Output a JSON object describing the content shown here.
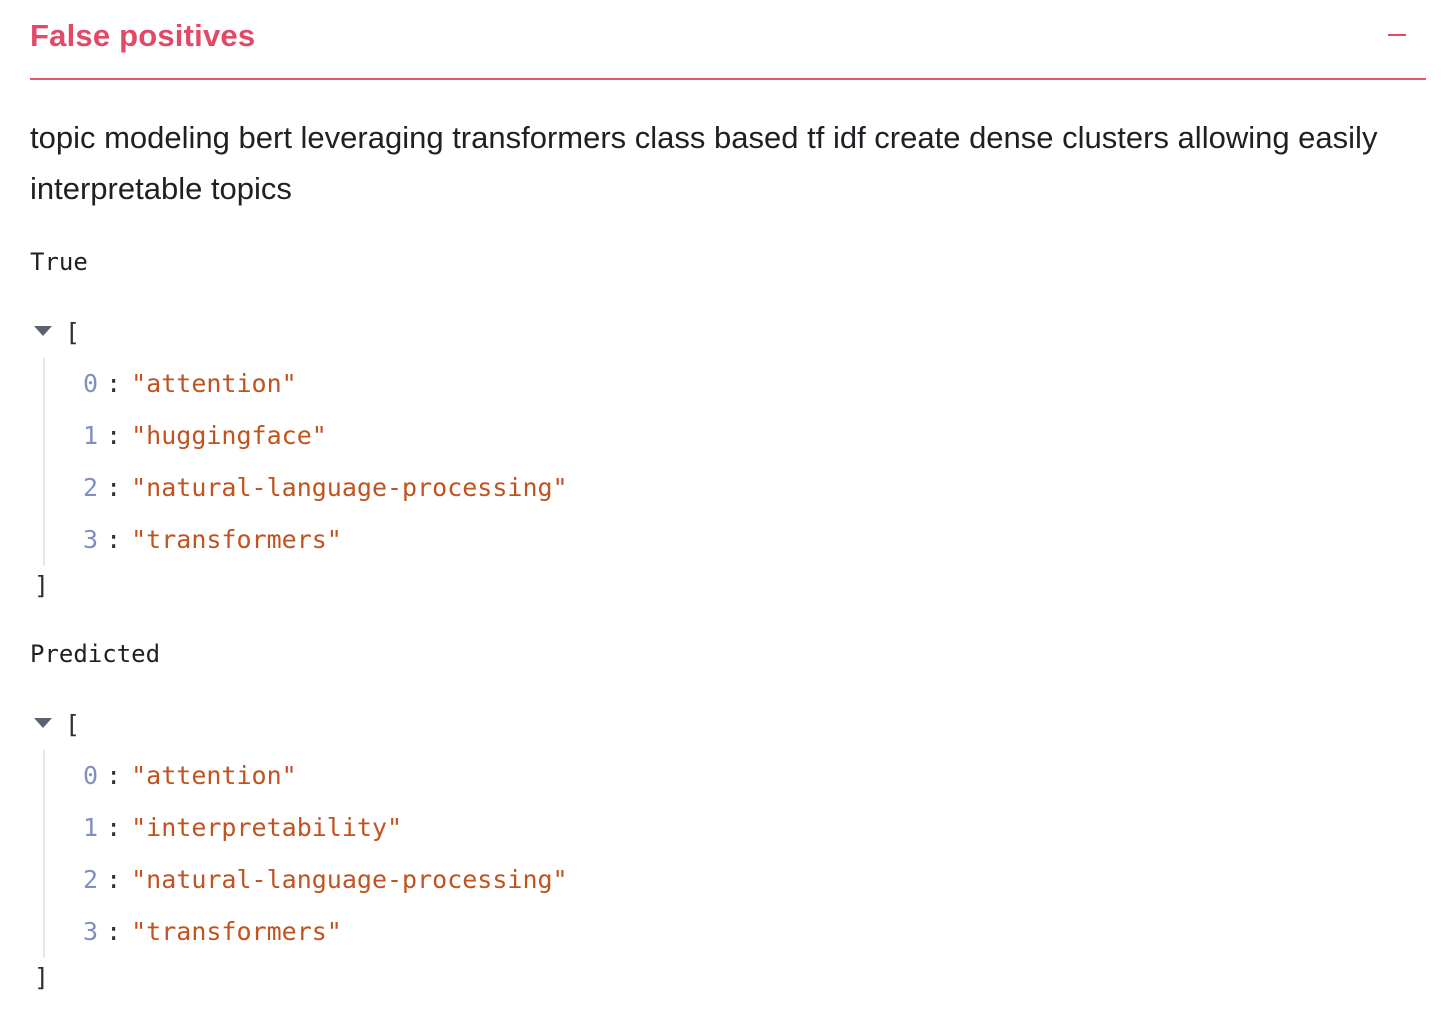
{
  "expander": {
    "title": "False positives",
    "collapse_icon": "minus-icon",
    "accent_color": "#e04a66"
  },
  "description": "topic modeling bert leveraging transformers class based tf idf create dense clusters allowing easily interpretable topics",
  "true_section": {
    "label": "True",
    "open_bracket": "[",
    "close_bracket": "]",
    "items": [
      {
        "index": "0",
        "value": "\"attention\""
      },
      {
        "index": "1",
        "value": "\"huggingface\""
      },
      {
        "index": "2",
        "value": "\"natural-language-processing\""
      },
      {
        "index": "3",
        "value": "\"transformers\""
      }
    ]
  },
  "predicted_section": {
    "label": "Predicted",
    "open_bracket": "[",
    "close_bracket": "]",
    "items": [
      {
        "index": "0",
        "value": "\"attention\""
      },
      {
        "index": "1",
        "value": "\"interpretability\""
      },
      {
        "index": "2",
        "value": "\"natural-language-processing\""
      },
      {
        "index": "3",
        "value": "\"transformers\""
      }
    ]
  },
  "colors": {
    "json_index": "#8090c0",
    "json_string": "#c0531f"
  }
}
